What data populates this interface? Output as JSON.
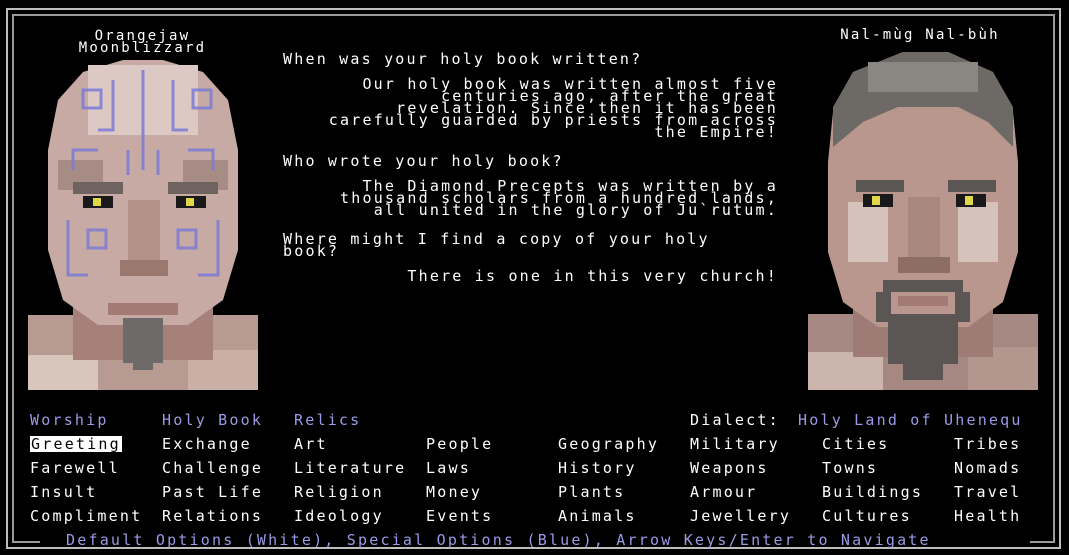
{
  "npc_left": {
    "name": "Orangejaw Moonblizzard"
  },
  "npc_right": {
    "name": "Nal-mùg Nal-bùh"
  },
  "dialogue": [
    {
      "question": "When was your holy book written?",
      "answer_lines": [
        "Our holy book was written almost five",
        "centuries ago, after the great",
        "revelation. Since then it has been",
        "carefully guarded by priests from across",
        "the Empire!"
      ]
    },
    {
      "question": "Who wrote your holy book?",
      "answer_lines": [
        "The Diamond Precepts was written by a",
        "thousand scholars from a hundred lands,",
        "all united in the glory of Ju`rutum."
      ]
    },
    {
      "question_lines": [
        "Where might I find a copy of your holy",
        "book?"
      ],
      "answer_lines": [
        "There is one in this very church!"
      ]
    }
  ],
  "special_options": [
    "Worship",
    "Holy Book",
    "Relics"
  ],
  "dialect": {
    "label": "Dialect:",
    "value": "Holy Land of Uhenequ"
  },
  "menu": {
    "col1": [
      "Greeting",
      "Farewell",
      "Insult",
      "Compliment"
    ],
    "col2": [
      "Exchange",
      "Challenge",
      "Past Life",
      "Relations"
    ],
    "col3": [
      "Art",
      "Literature",
      "Religion",
      "Ideology"
    ],
    "col4": [
      "People",
      "Laws",
      "Money",
      "Events"
    ],
    "col5": [
      "Geography",
      "History",
      "Plants",
      "Animals"
    ],
    "col6": [
      "Military",
      "Weapons",
      "Armour",
      "Jewellery"
    ],
    "col7": [
      "Cities",
      "Towns",
      "Buildings",
      "Cultures"
    ],
    "col8": [
      "Tribes",
      "Nomads",
      "Travel",
      "Health"
    ],
    "selected": "Greeting"
  },
  "footer": "Default Options (White), Special Options (Blue), Arrow Keys/Enter to Navigate",
  "colors": {
    "background": "#000000",
    "default_option": "#ffffff",
    "special_option": "#9a9ae6",
    "frame": "#bdbdbd"
  }
}
